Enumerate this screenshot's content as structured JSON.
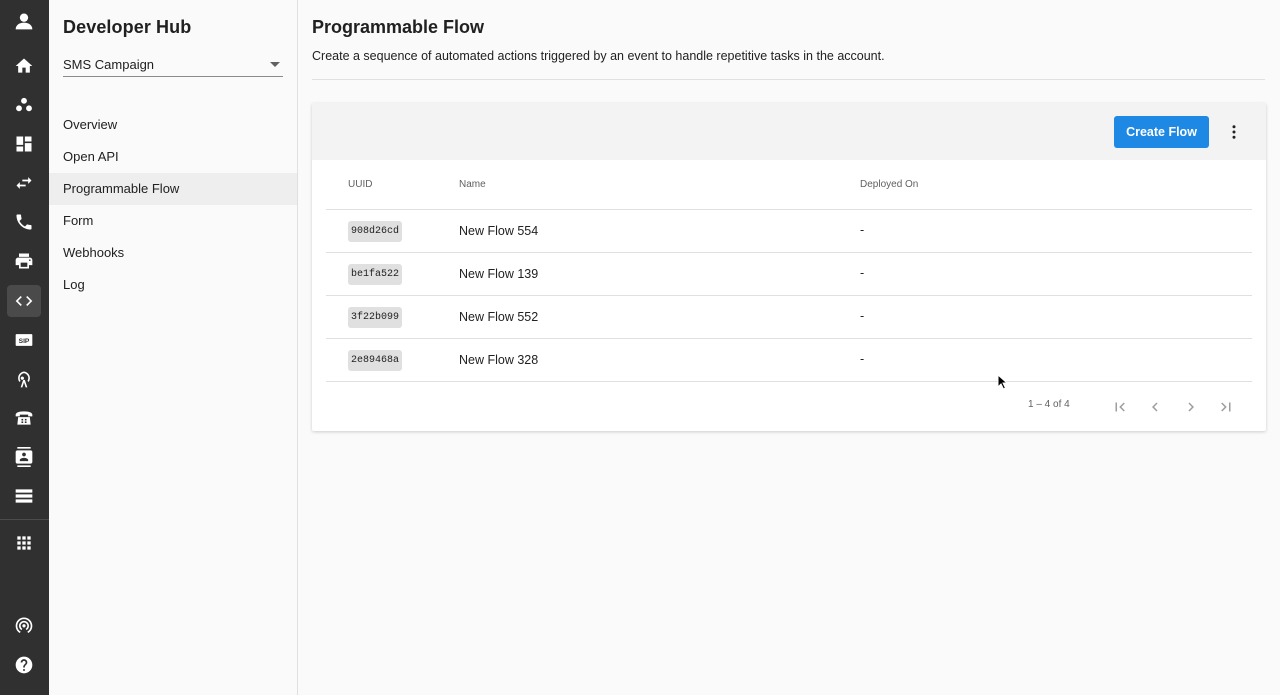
{
  "rail": {
    "items": [
      {
        "icon": "account-icon"
      },
      {
        "icon": "home-icon"
      },
      {
        "icon": "group-icon"
      },
      {
        "icon": "dashboard-icon"
      },
      {
        "icon": "swap-icon"
      },
      {
        "icon": "phone-icon"
      },
      {
        "icon": "printer-icon"
      },
      {
        "icon": "code-icon",
        "active": true
      },
      {
        "icon": "sip-icon",
        "text": "SIP"
      },
      {
        "icon": "antenna-icon"
      },
      {
        "icon": "desk-phone-icon"
      },
      {
        "icon": "contacts-icon"
      },
      {
        "icon": "list-icon"
      },
      {
        "icon": "apps-icon"
      },
      {
        "icon": "broadcast-icon"
      },
      {
        "icon": "help-icon"
      }
    ]
  },
  "sidebar": {
    "title": "Developer Hub",
    "selector": {
      "value": "SMS Campaign"
    },
    "items": [
      {
        "label": "Overview"
      },
      {
        "label": "Open API"
      },
      {
        "label": "Programmable Flow",
        "active": true
      },
      {
        "label": "Form"
      },
      {
        "label": "Webhooks"
      },
      {
        "label": "Log"
      }
    ]
  },
  "main": {
    "title": "Programmable Flow",
    "description": "Create a sequence of automated actions triggered by an event to handle repetitive tasks in the account.",
    "toolbar": {
      "create_label": "Create Flow",
      "more_icon": "more-vert-icon"
    },
    "table": {
      "columns": [
        "UUID",
        "Name",
        "Deployed On"
      ],
      "rows": [
        {
          "uuid": "908d26cd",
          "name": "New Flow 554",
          "deployed": "-"
        },
        {
          "uuid": "be1fa522",
          "name": "New Flow 139",
          "deployed": "-"
        },
        {
          "uuid": "3f22b099",
          "name": "New Flow 552",
          "deployed": "-"
        },
        {
          "uuid": "2e89468a",
          "name": "New Flow 328",
          "deployed": "-"
        }
      ]
    },
    "pagination": {
      "range": "1 – 4 of 4"
    }
  }
}
